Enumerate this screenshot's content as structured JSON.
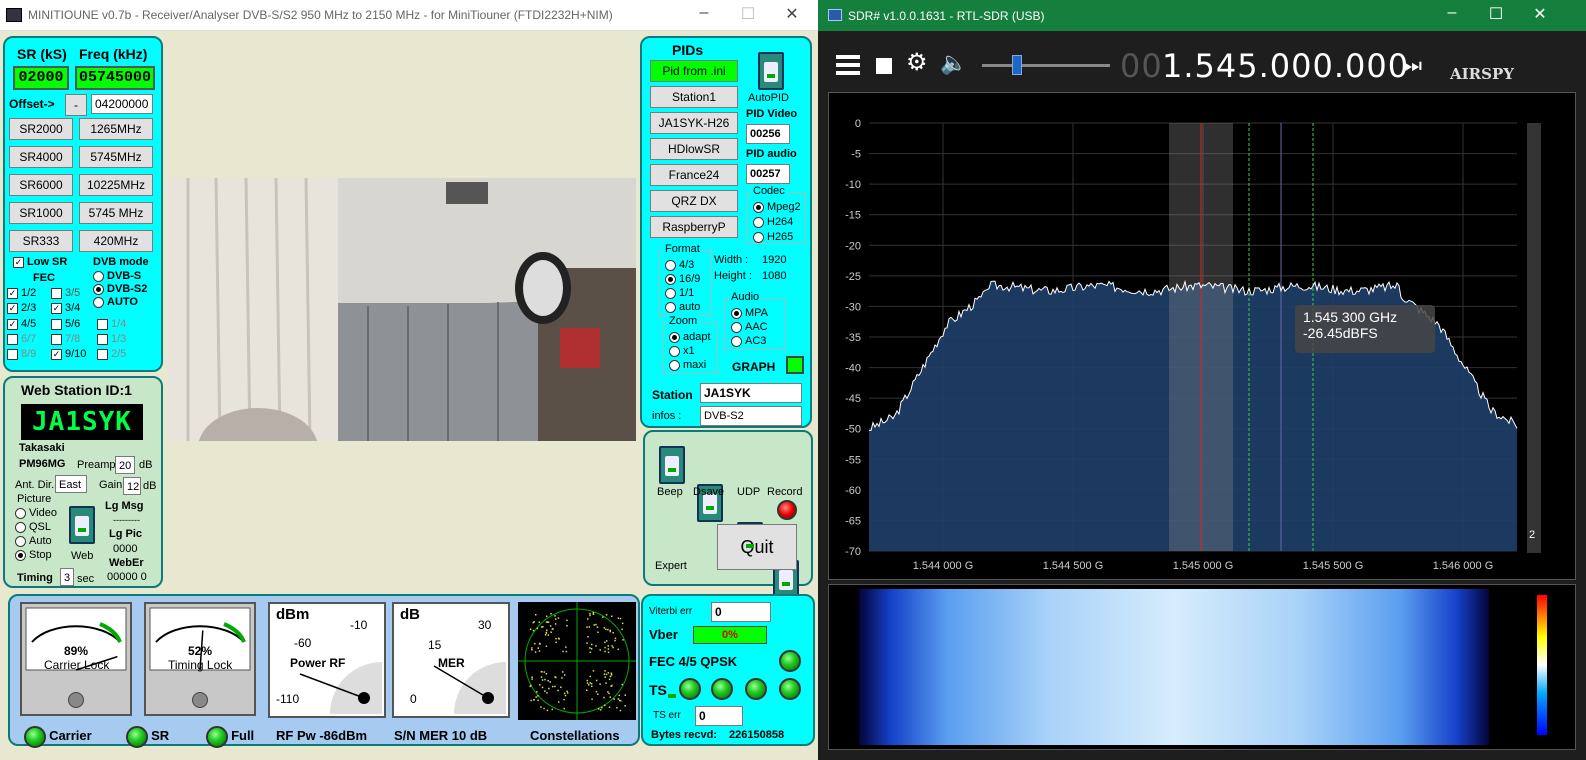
{
  "minitioune": {
    "title": "MINITIOUNE v0.7b - Receiver/Analyser DVB-S/S2 950 MHz to 2150 MHz - for MiniTiouner (FTDI2232H+NIM)",
    "sr_label": "SR (kS)",
    "freq_label": "Freq (kHz)",
    "sr_value": "02000",
    "freq_value": "05745000",
    "offset_label": "Offset->",
    "offset_sign": "-",
    "offset_value": "04200000",
    "sr_buttons": [
      "SR2000",
      "SR4000",
      "SR6000",
      "SR1000",
      "SR333"
    ],
    "freq_buttons": [
      "1265MHz",
      "5745MHz",
      "10225MHz",
      "5745 MHz",
      "420MHz"
    ],
    "low_sr": "Low SR",
    "fec_label": "FEC",
    "fec": [
      "1/2",
      "3/5",
      "2/3",
      "3/4",
      "4/5",
      "5/6",
      "6/7",
      "7/8",
      "8/9",
      "9/10",
      "1/4",
      "1/3",
      "2/5"
    ],
    "dvb_mode_label": "DVB mode",
    "dvb_modes": [
      "DVB-S",
      "DVB-S2",
      "AUTO"
    ],
    "web_station_label": "Web Station ID:1",
    "callsign_display": "JA1SYK",
    "city": "Takasaki",
    "locator": "PM96MG",
    "preamp_label": "Preamp",
    "preamp_value": "20",
    "preamp_unit": "dB",
    "ant_dir_label": "Ant. Dir.",
    "ant_dir_value": "East",
    "gain_label": "Gain",
    "gain_value": "12",
    "gain_unit": "dB",
    "picture_label": "Picture",
    "picture_opts": [
      "Video",
      "QSL",
      "Auto",
      "Stop"
    ],
    "web_label": "Web",
    "lg_msg": "Lg Msg",
    "lg_msg_value": "---------",
    "lg_pic": "Lg Pic",
    "lg_pic_value": "0000",
    "weber": "WebEr",
    "weber_value": "00000 0",
    "timing_label": "Timing",
    "timing_value": "3",
    "timing_unit": "sec",
    "pids_label": "PIDs",
    "pid_buttons": [
      "Pid from .ini",
      "Station1",
      "JA1SYK-H26",
      "HDlowSR",
      "France24",
      "QRZ DX",
      "RaspberryP"
    ],
    "autopid": "AutoPID",
    "pid_video_label": "PID Video",
    "pid_video": "00256",
    "pid_audio_label": "PID audio",
    "pid_audio": "00257",
    "codec_label": "Codec",
    "codecs": [
      "Mpeg2",
      "H264",
      "H265"
    ],
    "format_label": "Format",
    "formats": [
      "4/3",
      "16/9",
      "1/1",
      "auto"
    ],
    "width_label": "Width :",
    "width_value": "1920",
    "height_label": "Height :",
    "height_value": "1080",
    "audio_label": "Audio",
    "audios": [
      "MPA",
      "AAC",
      "AC3"
    ],
    "zoom_label": "Zoom",
    "zooms": [
      "adapt",
      "x1",
      "maxi"
    ],
    "graph_label": "GRAPH",
    "station_label": "Station",
    "station_value": "JA1SYK",
    "infos_label": "infos :",
    "infos_value": "DVB-S2",
    "switches": [
      "Beep",
      "Dsave",
      "UDP",
      "Record"
    ],
    "expert": "Expert",
    "quit": "Quit",
    "carrier_lock_pct": "89%",
    "carrier_lock_label": "Carrier Lock",
    "carrier_lock_level": 0.89,
    "timing_lock_pct": "52%",
    "timing_lock_label": "Timing Lock",
    "timing_lock_level": 0.52,
    "power_unit": "dBm",
    "power_ticks": [
      "-60",
      "-10",
      "-110"
    ],
    "power_label": "Power RF",
    "mer_unit": "dB",
    "mer_ticks": [
      "15",
      "30",
      "0"
    ],
    "mer_label": "MER",
    "viterbi_label": "Viterbi err",
    "viterbi_value": "0",
    "vber_label": "Vber",
    "vber_value": "0%",
    "fec_mode": "FEC 4/5 QPSK",
    "ts_label": "TS",
    "ts_err_label": "TS err",
    "ts_err_value": "0",
    "status_carrier": "Carrier",
    "status_sr": "SR",
    "status_full": "Full",
    "rf_pw": "RF Pw  -86dBm",
    "sn_mer": "S/N MER   10 dB",
    "constellations": "Constellations",
    "bytes_label": "Bytes recvd:",
    "bytes_value": "226150858"
  },
  "sdr": {
    "title": "SDR# v1.0.0.1631 - RTL-SDR (USB)",
    "freq_dim": "00",
    "freq_main": "1.545.000.000",
    "logo": "AIRSPY",
    "cursor_freq": "1.545 300 GHz",
    "cursor_level": "-26.45dBFS",
    "y_ticks": [
      "0",
      "-5",
      "-10",
      "-15",
      "-20",
      "-25",
      "-30",
      "-35",
      "-40",
      "-45",
      "-50",
      "-55",
      "-60",
      "-65",
      "-70"
    ],
    "x_ticks": [
      "1.544 000 G",
      "1.544 500 G",
      "1.545 000 G",
      "1.545 500 G",
      "1.546 000 G"
    ],
    "side_number": "2",
    "accent": "#15803d"
  }
}
